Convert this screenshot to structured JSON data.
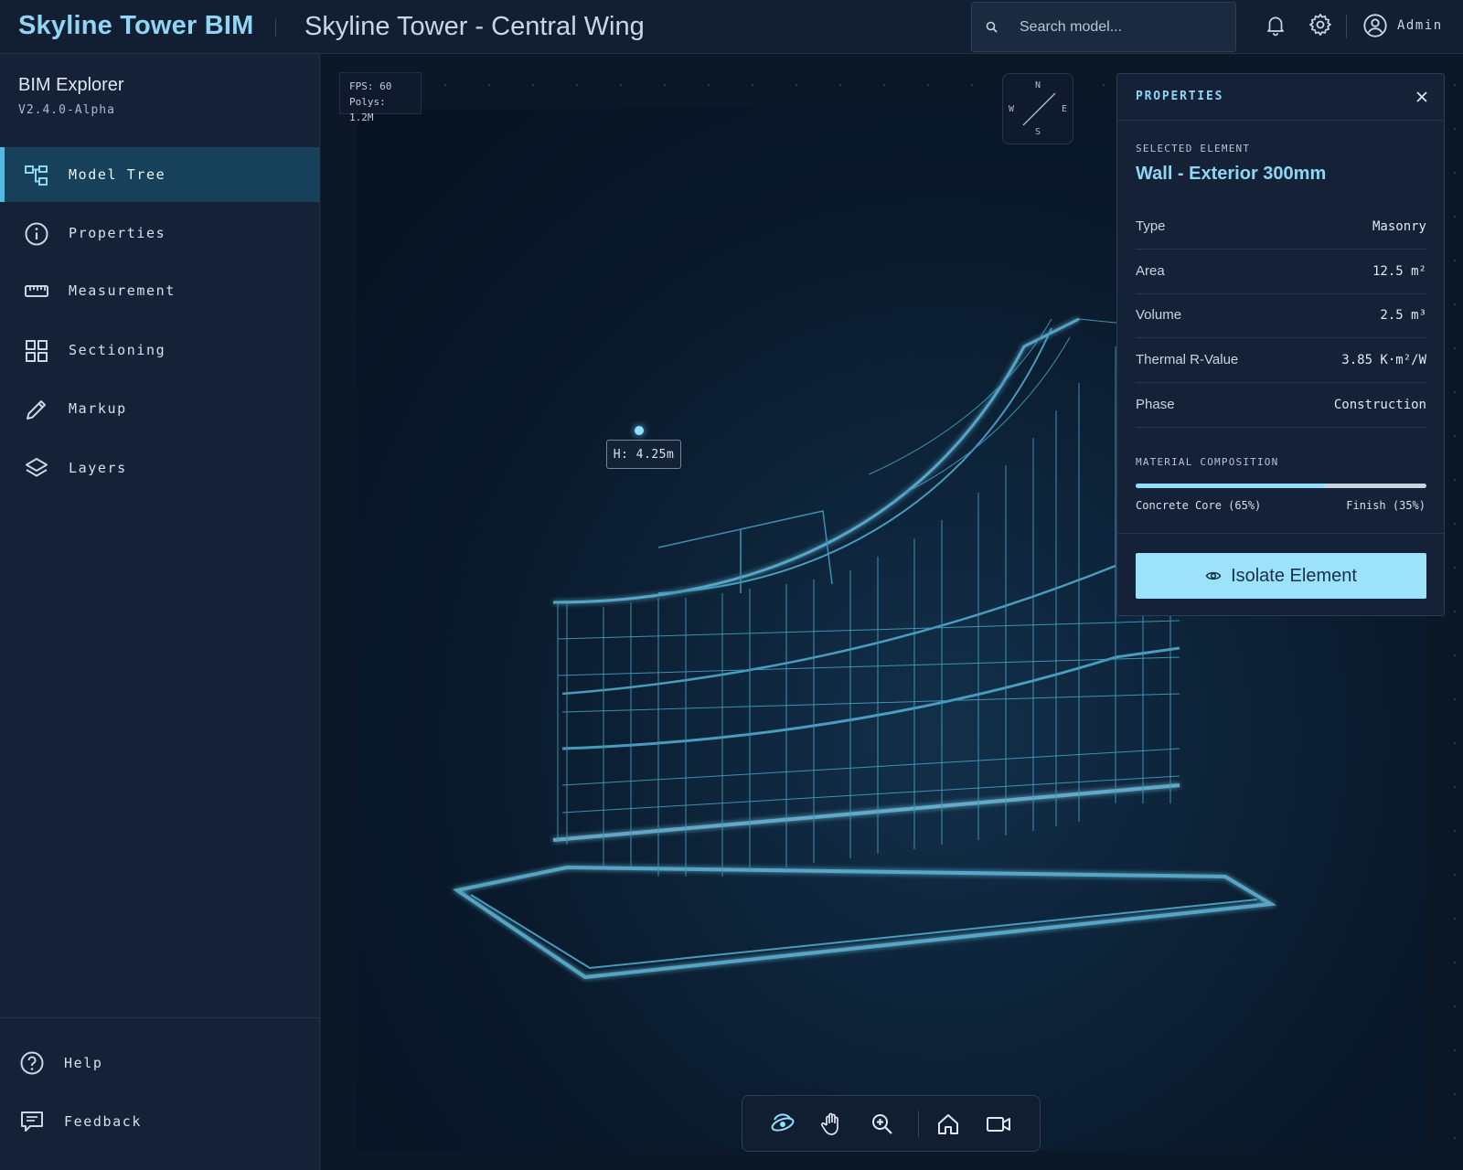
{
  "app": {
    "brand": "Skyline Tower BIM",
    "project_title": "Skyline Tower - Central Wing",
    "search_placeholder": "Search model...",
    "user": "Admin"
  },
  "sidebar": {
    "title": "BIM Explorer",
    "version": "V2.4.0-Alpha",
    "items": [
      {
        "label": "Model Tree",
        "icon": "model-tree-icon",
        "active": true
      },
      {
        "label": "Properties",
        "icon": "info-icon"
      },
      {
        "label": "Measurement",
        "icon": "ruler-icon"
      },
      {
        "label": "Sectioning",
        "icon": "grid-icon"
      },
      {
        "label": "Markup",
        "icon": "pencil-icon"
      },
      {
        "label": "Layers",
        "icon": "layers-icon"
      }
    ],
    "footer": [
      {
        "label": "Help",
        "icon": "help-icon"
      },
      {
        "label": "Feedback",
        "icon": "feedback-icon"
      }
    ]
  },
  "viewport": {
    "fps": "FPS: 60",
    "polys": "Polys: 1.2M",
    "compass": {
      "n": "N",
      "s": "S",
      "e": "E",
      "w": "W"
    },
    "marker_label": "H: 4.25m",
    "toolbar": [
      "orbit-icon",
      "pan-hand-icon",
      "zoom-icon",
      "home-icon",
      "camera-icon"
    ]
  },
  "properties": {
    "title": "PROPERTIES",
    "selected_label": "SELECTED ELEMENT",
    "selected_value": "Wall - Exterior 300mm",
    "rows": [
      {
        "key": "Type",
        "value": "Masonry"
      },
      {
        "key": "Area",
        "value": "12.5 m²"
      },
      {
        "key": "Volume",
        "value": "2.5 m³"
      },
      {
        "key": "Thermal R-Value",
        "value": "3.85 K·m²/W"
      },
      {
        "key": "Phase",
        "value": "Construction"
      }
    ],
    "material_label": "MATERIAL COMPOSITION",
    "material_left": "Concrete Core (65%)",
    "material_right": "Finish (35%)",
    "material_fraction": 0.65,
    "isolate_label": "Isolate Element"
  },
  "colors": {
    "accent": "#8fd6f5",
    "background": "#0f1a2b",
    "wireframe": "#4fb6dc"
  }
}
